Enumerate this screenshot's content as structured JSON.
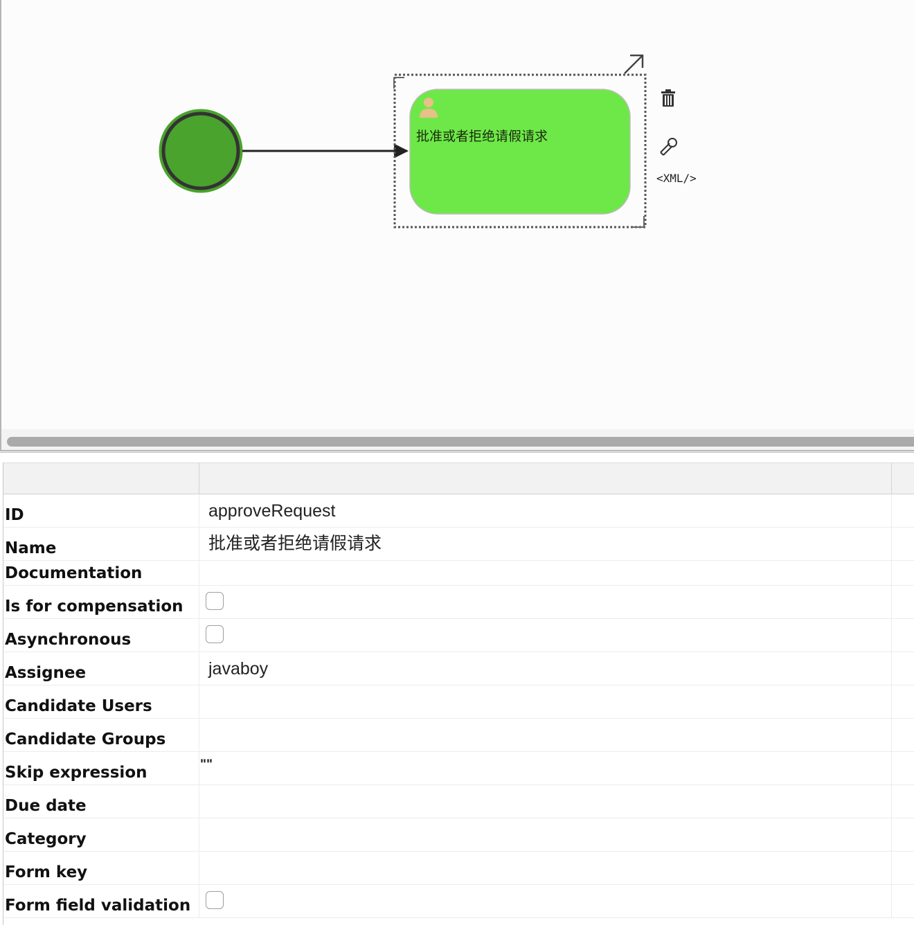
{
  "canvas": {
    "task": {
      "name": "批准或者拒绝请假请求",
      "fill_color": "#6ee848",
      "type_icon": "user-icon"
    },
    "start_event": {
      "fill_color": "#4aa32c"
    },
    "actions": {
      "delete_icon": "trash-icon",
      "edit_icon": "wrench-icon",
      "xml_label": "<XML/>",
      "connect_icon": "arrow-up-right-icon"
    }
  },
  "properties": {
    "rows": [
      {
        "label": "ID",
        "value": "approveRequest",
        "kind": "text"
      },
      {
        "label": "Name",
        "value": "批准或者拒绝请假请求",
        "kind": "text"
      },
      {
        "label": "Documentation",
        "value": "",
        "kind": "text"
      },
      {
        "label": "Is for compensation",
        "checked": false,
        "kind": "checkbox"
      },
      {
        "label": "Asynchronous",
        "checked": false,
        "kind": "checkbox"
      },
      {
        "label": "Assignee",
        "value": "javaboy",
        "kind": "text"
      },
      {
        "label": "Candidate Users",
        "value": "",
        "kind": "text"
      },
      {
        "label": "Candidate Groups",
        "value": "",
        "kind": "text"
      },
      {
        "label": "Skip expression",
        "value": "\"\"",
        "kind": "text"
      },
      {
        "label": "Due date",
        "value": "",
        "kind": "text"
      },
      {
        "label": "Category",
        "value": "",
        "kind": "text"
      },
      {
        "label": "Form key",
        "value": "",
        "kind": "text"
      },
      {
        "label": "Form field validation",
        "checked": false,
        "kind": "checkbox"
      }
    ]
  }
}
